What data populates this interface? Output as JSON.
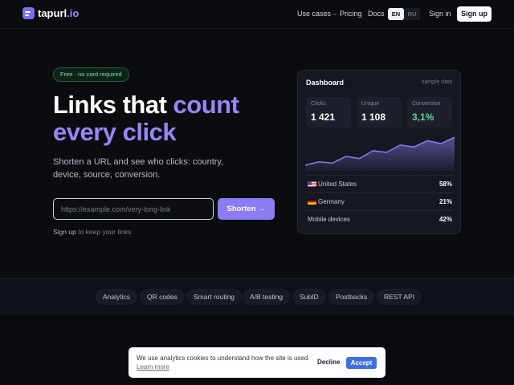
{
  "header": {
    "logo_name": "tapurl",
    "logo_tld": ".io",
    "nav": {
      "use_cases": "Use cases",
      "pricing": "Pricing",
      "docs": "Docs",
      "sign_in": "Sign in",
      "sign_up": "Sign up"
    },
    "lang": {
      "en": "EN",
      "ru": "RU",
      "active": "EN"
    }
  },
  "hero": {
    "badge": "Free · no card required",
    "title_line1": "Links that ",
    "title_accent1": "count",
    "title_accent2": "every click",
    "subtitle": "Shorten a URL and see who clicks: country, device, source, conversion.",
    "input_placeholder": "https://example.com/very-long-link",
    "shorten_label": "Shorten →",
    "signup_link": "Sign up",
    "signup_rest": " to keep your links"
  },
  "dashboard": {
    "title": "Dashboard",
    "tag": "sample data",
    "stats": [
      {
        "label": "Clicks",
        "value": "1 421"
      },
      {
        "label": "Unique",
        "value": "1 108"
      },
      {
        "label": "Conversion",
        "value": "3,1%"
      }
    ],
    "rows": [
      {
        "label": "United States",
        "value": "58%",
        "flag": "us"
      },
      {
        "label": "Germany",
        "value": "21%",
        "flag": "de"
      },
      {
        "label": "Mobile devices",
        "value": "42%",
        "flag": ""
      }
    ],
    "chart_series": [
      0.12,
      0.22,
      0.18,
      0.38,
      0.32,
      0.55,
      0.5,
      0.72,
      0.66,
      0.85,
      0.76,
      0.95
    ],
    "accent_color": "#8b7cf3"
  },
  "features": [
    "Analytics",
    "QR codes",
    "Smart routing",
    "A/B testing",
    "SubID",
    "Postbacks",
    "REST API"
  ],
  "cookie": {
    "text": "We use analytics cookies to understand how the site is used.",
    "learn_more": "Learn more",
    "decline": "Decline",
    "accept": "Accept"
  }
}
